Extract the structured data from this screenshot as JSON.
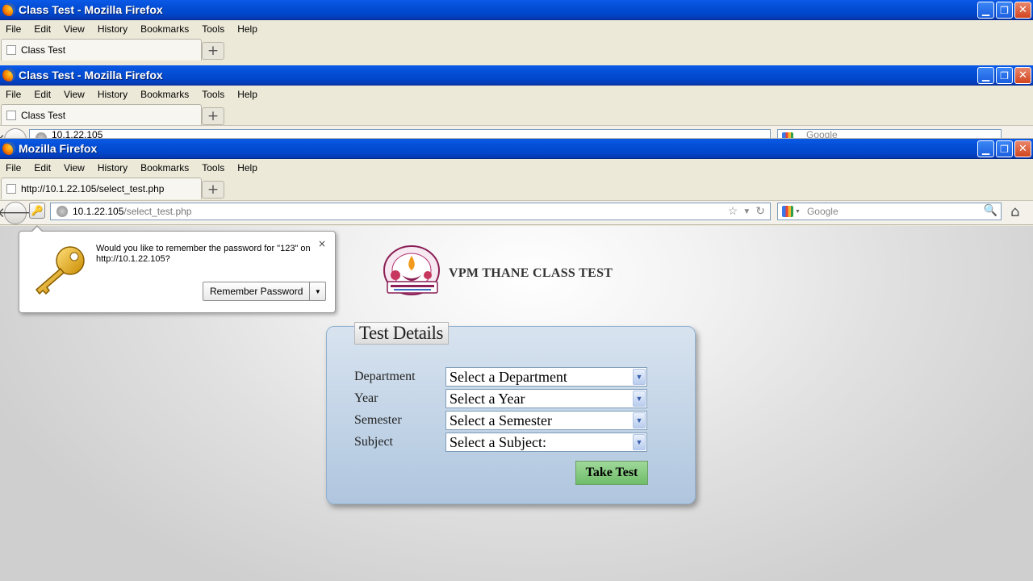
{
  "windows": [
    {
      "title": "Class Test - Mozilla Firefox",
      "tab_label": "Class Test"
    },
    {
      "title": "Class Test - Mozilla Firefox",
      "tab_label": "Class Test",
      "url_fragment": "10.1.22.105",
      "search_placeholder": "Google"
    },
    {
      "title": "Mozilla Firefox",
      "tab_label": "http://10.1.22.105/select_test.php"
    }
  ],
  "window_buttons": {
    "minimize": "▁",
    "restore": "❐",
    "close": "✕"
  },
  "menus": [
    "File",
    "Edit",
    "View",
    "History",
    "Bookmarks",
    "Tools",
    "Help"
  ],
  "navbar": {
    "url_host": "10.1.22.105",
    "url_path": "/select_test.php",
    "search_placeholder": "Google"
  },
  "password_popup": {
    "message": "Would you like to remember the password for \"123\" on http://10.1.22.105?",
    "button_label": "Remember Password",
    "close_label": "×"
  },
  "page": {
    "site_title": "VPM THANE CLASS TEST",
    "form": {
      "legend": "Test Details",
      "fields": [
        {
          "label": "Department",
          "value": "Select a Department"
        },
        {
          "label": "Year",
          "value": "Select a Year"
        },
        {
          "label": "Semester",
          "value": "Select a Semester"
        },
        {
          "label": "Subject",
          "value": "Select a Subject:"
        }
      ],
      "submit_label": "Take Test"
    }
  }
}
